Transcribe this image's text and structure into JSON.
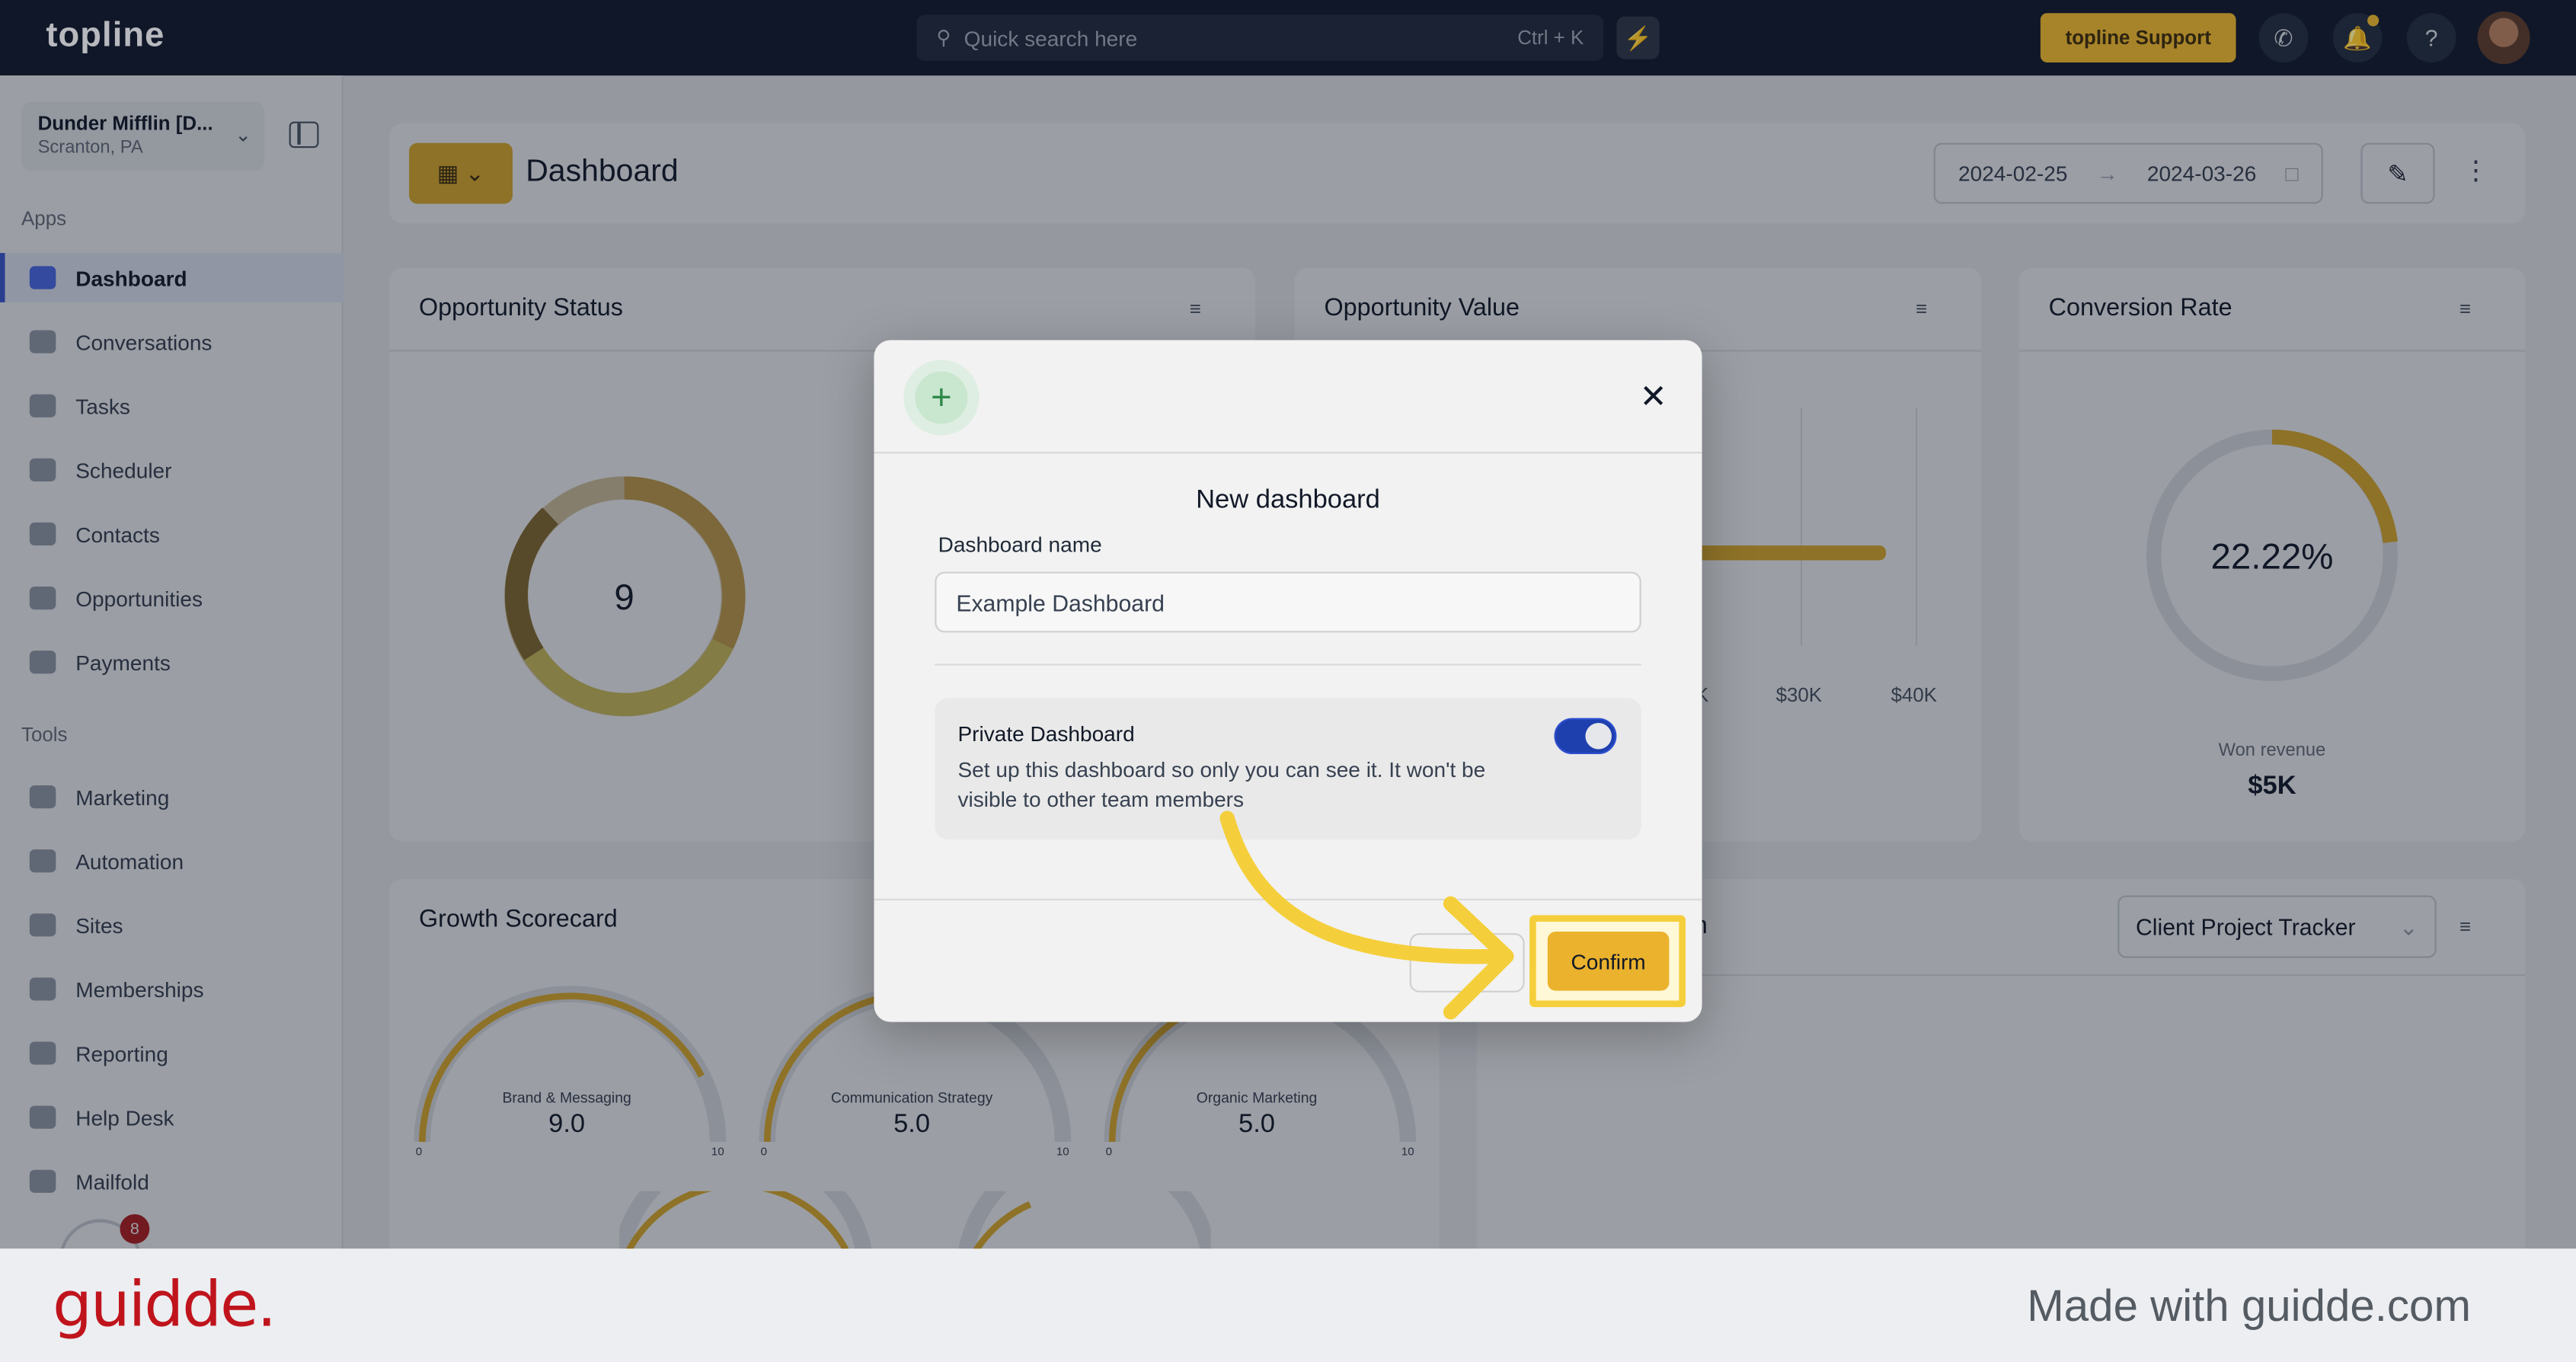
{
  "topbar": {
    "logo": "topline",
    "search_placeholder": "Quick search here",
    "search_shortcut": "Ctrl + K",
    "support_label": "topline Support"
  },
  "sidebar": {
    "location_name": "Dunder Mifflin [D...",
    "location_sub": "Scranton, PA",
    "apps_label": "Apps",
    "apps": [
      {
        "label": "Dashboard",
        "active": true
      },
      {
        "label": "Conversations"
      },
      {
        "label": "Tasks"
      },
      {
        "label": "Scheduler"
      },
      {
        "label": "Contacts"
      },
      {
        "label": "Opportunities"
      },
      {
        "label": "Payments"
      }
    ],
    "tools_label": "Tools",
    "tools": [
      {
        "label": "Marketing"
      },
      {
        "label": "Automation"
      },
      {
        "label": "Sites"
      },
      {
        "label": "Memberships"
      },
      {
        "label": "Reporting"
      },
      {
        "label": "Help Desk"
      },
      {
        "label": "Mailfold"
      }
    ],
    "chat_badge": "8"
  },
  "header": {
    "title": "Dashboard",
    "date_start": "2024-02-25",
    "date_end": "2024-03-26"
  },
  "cards": {
    "opportunity_status": {
      "title": "Opportunity Status",
      "center_value": "9"
    },
    "opportunity_value": {
      "title": "Opportunity Value",
      "ticks": [
        "K",
        "$30K",
        "$40K"
      ]
    },
    "conversion_rate": {
      "title": "Conversion Rate",
      "value": "22.22%",
      "caption": "Won revenue",
      "revenue": "$5K"
    },
    "growth_scorecard": {
      "title": "Growth Scorecard",
      "gauges": [
        {
          "label": "Brand & Messaging",
          "value": "9.0",
          "min": "0",
          "max": "10"
        },
        {
          "label": "Communication Strategy",
          "value": "5.0",
          "min": "0",
          "max": "10"
        },
        {
          "label": "Organic Marketing",
          "value": "5.0",
          "min": "0",
          "max": "10"
        }
      ]
    },
    "project_card": {
      "title_fragment": "n",
      "select_value": "Client Project Tracker"
    }
  },
  "modal": {
    "title": "New dashboard",
    "field_label": "Dashboard name",
    "field_value": "Example Dashboard",
    "private_title": "Private Dashboard",
    "private_desc": "Set up this dashboard so only you can see it. It won't be visible to other team members",
    "private_enabled": true,
    "confirm_label": "Confirm"
  },
  "footer": {
    "brand": "guidde.",
    "tagline": "Made with guidde.com"
  },
  "colors": {
    "accent": "#e8b42a",
    "topbar": "#0f1729",
    "toggle_on": "#1e40af",
    "brand_red": "#c0141d"
  }
}
